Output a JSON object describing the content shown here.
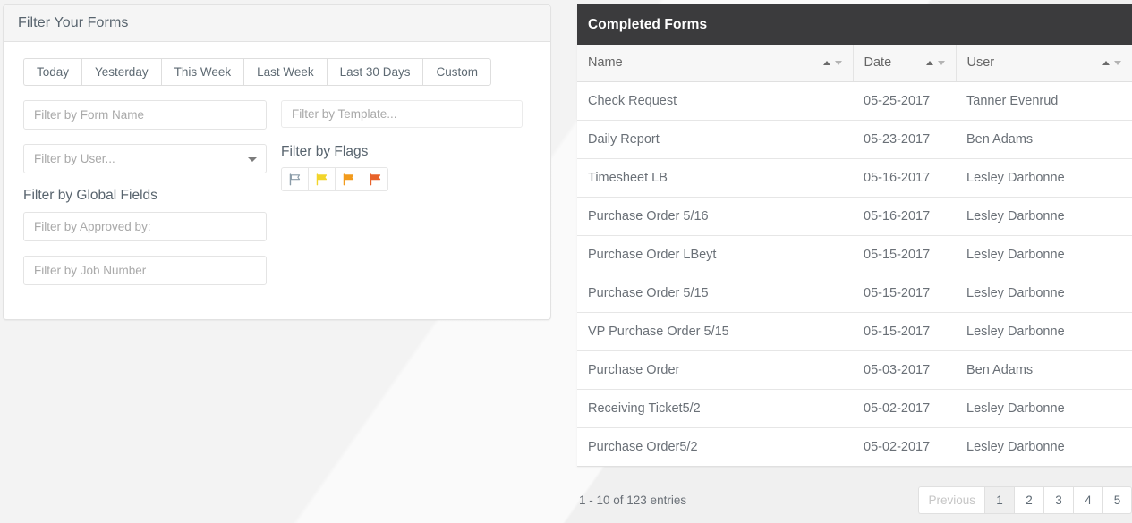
{
  "filter_panel": {
    "title": "Filter Your Forms",
    "date_ranges": [
      {
        "label": "Today"
      },
      {
        "label": "Yesterday"
      },
      {
        "label": "This Week"
      },
      {
        "label": "Last Week"
      },
      {
        "label": "Last 30 Days"
      },
      {
        "label": "Custom"
      }
    ],
    "form_name_input": {
      "value": "",
      "placeholder": "Filter by Form Name"
    },
    "template_input": {
      "value": "",
      "placeholder": "Filter by Template..."
    },
    "user_select": {
      "value": "Filter by User...",
      "icon": "chevron-down-icon"
    },
    "flags_label": "Filter by Flags",
    "flags": [
      {
        "name": "flag-none",
        "color": "#8a9ba8",
        "filled": false
      },
      {
        "name": "flag-yellow",
        "color": "#f2d52b",
        "filled": true
      },
      {
        "name": "flag-orange",
        "color": "#f29b1d",
        "filled": true
      },
      {
        "name": "flag-red",
        "color": "#e8622a",
        "filled": true
      }
    ],
    "global_fields_label": "Filter by Global Fields",
    "approved_by_input": {
      "value": "",
      "placeholder": "Filter by Approved by:"
    },
    "job_number_input": {
      "value": "",
      "placeholder": "Filter by Job Number"
    }
  },
  "table_panel": {
    "title": "Completed Forms",
    "columns": [
      {
        "label": "Name",
        "sort_icon": "sort-arrows-icon"
      },
      {
        "label": "Date",
        "sort_icon": "sort-arrows-icon"
      },
      {
        "label": "User",
        "sort_icon": "sort-arrows-icon"
      }
    ],
    "rows": [
      {
        "name": "Check Request",
        "date": "05-25-2017",
        "user": "Tanner Evenrud"
      },
      {
        "name": "Daily Report",
        "date": "05-23-2017",
        "user": "Ben Adams"
      },
      {
        "name": "Timesheet LB",
        "date": "05-16-2017",
        "user": "Lesley Darbonne"
      },
      {
        "name": "Purchase Order 5/16",
        "date": "05-16-2017",
        "user": "Lesley Darbonne"
      },
      {
        "name": "Purchase Order LBeyt",
        "date": "05-15-2017",
        "user": "Lesley Darbonne"
      },
      {
        "name": "Purchase Order 5/15",
        "date": "05-15-2017",
        "user": "Lesley Darbonne"
      },
      {
        "name": "VP Purchase Order 5/15",
        "date": "05-15-2017",
        "user": "Lesley Darbonne"
      },
      {
        "name": "Purchase Order",
        "date": "05-03-2017",
        "user": "Ben Adams"
      },
      {
        "name": "Receiving Ticket5/2",
        "date": "05-02-2017",
        "user": "Lesley Darbonne"
      },
      {
        "name": "Purchase Order5/2",
        "date": "05-02-2017",
        "user": "Lesley Darbonne"
      }
    ],
    "footer": {
      "entries_info": "1 - 10 of 123 entries",
      "pager": [
        {
          "label": "Previous",
          "state": "disabled"
        },
        {
          "label": "1",
          "state": "active"
        },
        {
          "label": "2",
          "state": "normal"
        },
        {
          "label": "3",
          "state": "normal"
        },
        {
          "label": "4",
          "state": "normal"
        },
        {
          "label": "5",
          "state": "normal"
        }
      ]
    }
  },
  "colors": {
    "header_bar": "#3b3b3d",
    "panel_head": "#f5f5f5",
    "page_background": "#f3f3f3",
    "text": "#6a7077"
  }
}
